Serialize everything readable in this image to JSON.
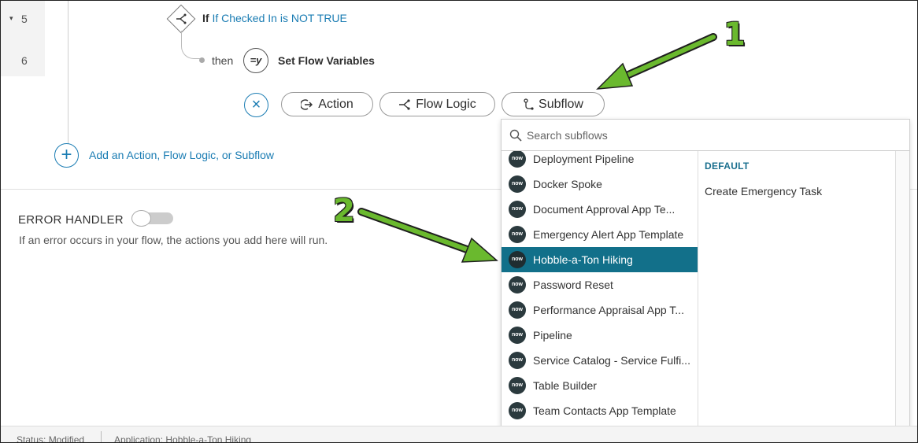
{
  "gutter": {
    "rows": [
      {
        "caret": "▾",
        "num": "5"
      },
      {
        "caret": "",
        "num": "6"
      }
    ]
  },
  "step5": {
    "keyword": "If",
    "condition": "If Checked In is NOT TRUE"
  },
  "step6": {
    "keyword": "then",
    "icon_text": "=y",
    "label": "Set Flow Variables"
  },
  "picker": {
    "close_icon": "close-icon",
    "buttons": [
      {
        "label": "Action",
        "icon": "action-icon"
      },
      {
        "label": "Flow Logic",
        "icon": "flow-logic-icon"
      },
      {
        "label": "Subflow",
        "icon": "subflow-icon"
      }
    ]
  },
  "add": {
    "label": "Add an Action, Flow Logic, or Subflow"
  },
  "error_handler": {
    "title": "ERROR HANDLER",
    "toggle_on": false,
    "description": "If an error occurs in your flow, the actions you add here will run."
  },
  "subflow_dropdown": {
    "search_placeholder": "Search subflows",
    "logo_text": "now",
    "items": [
      "Deployment Pipeline",
      "Docker Spoke",
      "Document Approval App Te...",
      "Emergency Alert App Template",
      "Hobble-a-Ton Hiking",
      "Password Reset",
      "Performance Appraisal App T...",
      "Pipeline",
      "Service Catalog - Service Fulfi...",
      "Table Builder",
      "Team Contacts App Template"
    ],
    "selected_index": 4,
    "detail_header": "DEFAULT",
    "detail_items": [
      "Create Emergency Task"
    ]
  },
  "status_bar": {
    "status": "Status: Modified",
    "application": "Application: Hobble-a-Ton Hiking"
  },
  "callouts": [
    {
      "label": "1"
    },
    {
      "label": "2"
    }
  ],
  "colors": {
    "accent": "#1a7cb3",
    "selected": "#12708a",
    "arrow": "#6ab92e"
  }
}
